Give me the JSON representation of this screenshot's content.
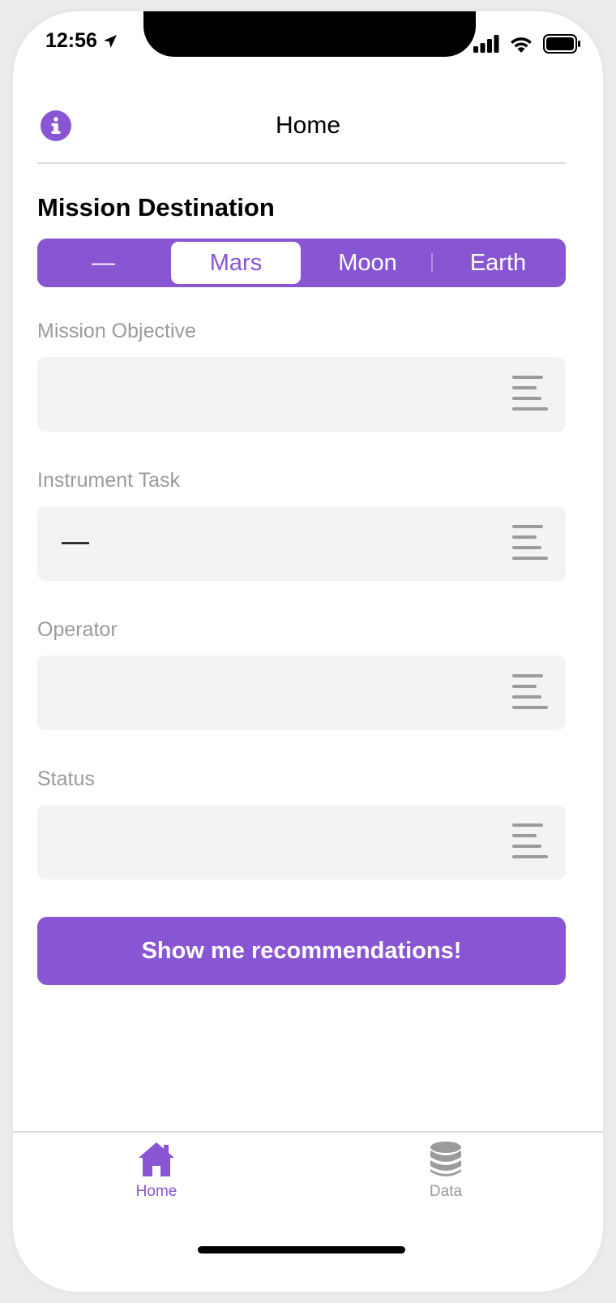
{
  "status_bar": {
    "time": "12:56",
    "icons": [
      "location-arrow-icon",
      "signal-icon",
      "wifi-icon",
      "battery-icon"
    ]
  },
  "header": {
    "title": "Home",
    "info_icon": "info-circle-icon"
  },
  "destination": {
    "title": "Mission Destination",
    "options": [
      "—",
      "Mars",
      "Moon",
      "Earth"
    ],
    "selected": "Mars"
  },
  "fields": {
    "objective": {
      "label": "Mission Objective",
      "value": ""
    },
    "task": {
      "label": "Instrument Task",
      "value": "—"
    },
    "operator": {
      "label": "Operator",
      "value": ""
    },
    "status": {
      "label": "Status",
      "value": ""
    }
  },
  "cta": {
    "label": "Show me recommendations!"
  },
  "tabbar": {
    "tabs": [
      {
        "label": "Home",
        "icon": "house-icon",
        "active": true
      },
      {
        "label": "Data",
        "icon": "database-icon",
        "active": false
      }
    ]
  },
  "colors": {
    "accent": "#8856d2",
    "field_bg": "#f3f3f3",
    "label_gray": "#9b9b9b",
    "inactive_tab": "#9b9b9b"
  }
}
